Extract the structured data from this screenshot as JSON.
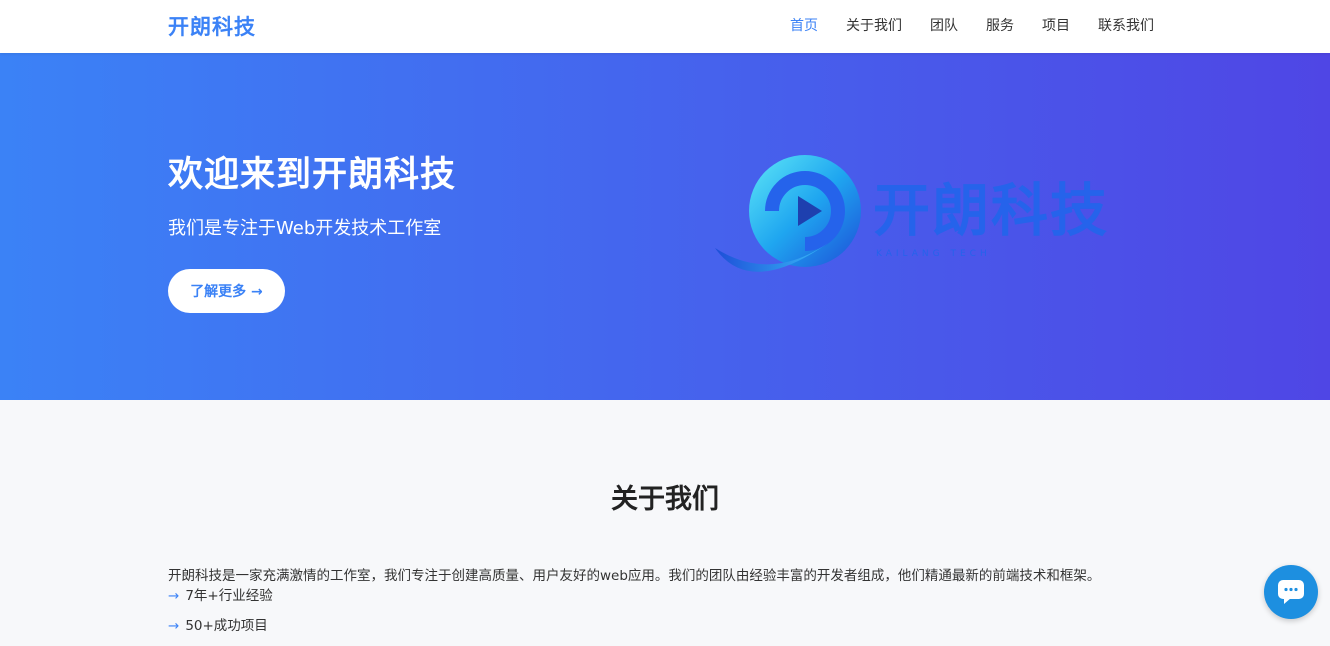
{
  "nav": {
    "brand": "开朗科技",
    "items": [
      {
        "label": "首页",
        "active": true
      },
      {
        "label": "关于我们",
        "active": false
      },
      {
        "label": "团队",
        "active": false
      },
      {
        "label": "服务",
        "active": false
      },
      {
        "label": "项目",
        "active": false
      },
      {
        "label": "联系我们",
        "active": false
      }
    ]
  },
  "hero": {
    "title": "欢迎来到开朗科技",
    "subtitle": "我们是专注于Web开发技术工作室",
    "button_label": "了解更多 →",
    "logo_text": "开朗科技",
    "logo_subtext": "KAILANG TECH"
  },
  "about": {
    "title": "关于我们",
    "description": "开朗科技是一家充满激情的工作室，我们专注于创建高质量、用户友好的web应用。我们的团队由经验丰富的开发者组成，他们精通最新的前端技术和框架。",
    "arrow": "→",
    "highlights": [
      "7年+行业经验",
      "50+成功项目"
    ]
  },
  "chat": {
    "icon": "chat-bubble-icon"
  },
  "colors": {
    "accent": "#3b82f6",
    "hero_start": "#3b82f6",
    "hero_end": "#4f46e5",
    "chat": "#1d8fe0"
  }
}
